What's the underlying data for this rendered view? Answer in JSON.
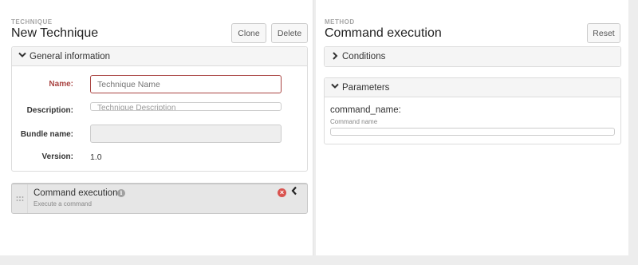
{
  "technique": {
    "kicker": "TECHNIQUE",
    "title": "New Technique",
    "clone_label": "Clone",
    "delete_label": "Delete",
    "general_header": "General information",
    "fields": {
      "name_label": "Name:",
      "name_placeholder": "Technique Name",
      "description_label": "Description:",
      "description_placeholder": "Technique Description",
      "bundle_label": "Bundle name:",
      "bundle_value": "",
      "version_label": "Version:",
      "version_value": "1.0"
    },
    "method_item": {
      "title": "Command execution",
      "description": "Execute a command"
    }
  },
  "method": {
    "kicker": "METHOD",
    "title": "Command execution",
    "reset_label": "Reset",
    "conditions_header": "Conditions",
    "parameters_header": "Parameters",
    "parameter": {
      "name": "command_name:",
      "description": "Command name",
      "value": ""
    }
  },
  "icons": {
    "expanded": "chevron-down-icon",
    "collapsed": "chevron-right-icon",
    "drag": "drag-handle-icon",
    "info": "info-icon",
    "remove": "remove-icon",
    "collapse_method": "chevron-left-icon"
  },
  "colors": {
    "required_label": "#a94442",
    "remove_icon": "#d9534f"
  }
}
